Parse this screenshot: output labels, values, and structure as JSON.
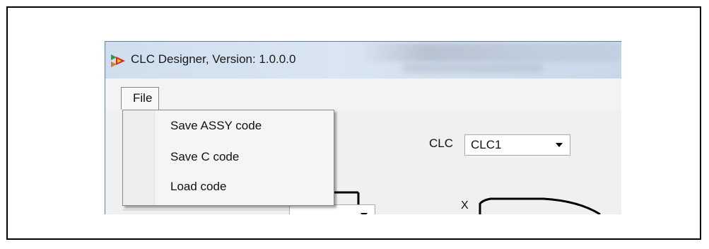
{
  "window": {
    "title": "CLC Designer, Version: 1.0.0.0"
  },
  "menubar": {
    "file_label": "File"
  },
  "file_menu": {
    "items": [
      {
        "label": "Save ASSY code"
      },
      {
        "label": "Save C code"
      },
      {
        "label": "Load code"
      }
    ]
  },
  "toolbar": {
    "clc_label": "CLC",
    "clc_select_value": "CLC1"
  },
  "diagram": {
    "x_label": "X"
  },
  "colors": {
    "titlebar": "#d9e5f2",
    "window_bg": "#f0f0f0",
    "menu_bg": "#f5f5f5"
  }
}
